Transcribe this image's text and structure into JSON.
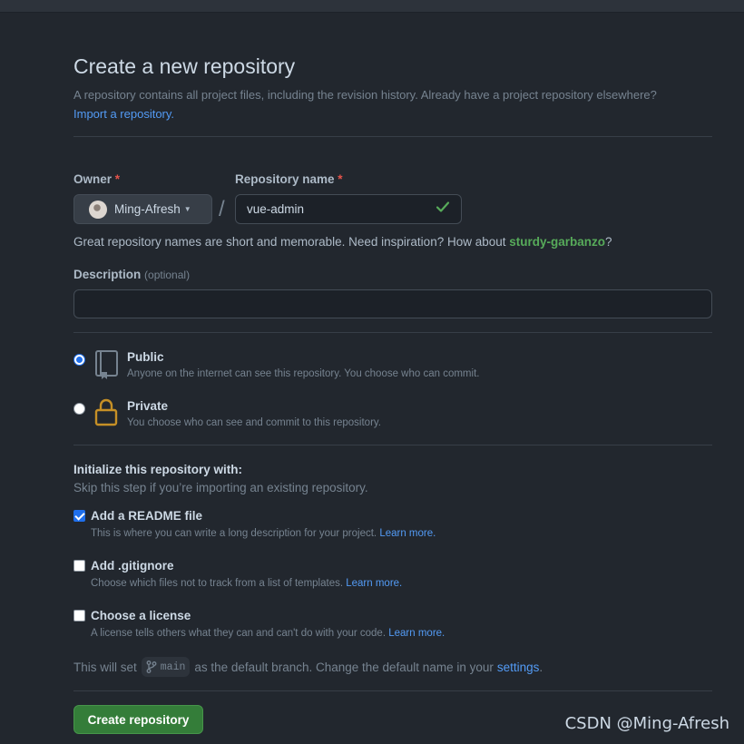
{
  "page": {
    "title": "Create a new repository",
    "subtitle": "A repository contains all project files, including the revision history. Already have a project repository elsewhere?",
    "import_link": "Import a repository."
  },
  "owner": {
    "label": "Owner",
    "required_mark": "*",
    "value": "Ming-Afresh",
    "separator": "/"
  },
  "repo_name": {
    "label": "Repository name",
    "required_mark": "*",
    "value": "vue-admin"
  },
  "hint": {
    "text": "Great repository names are short and memorable. Need inspiration? How about",
    "suggestion": "sturdy-garbanzo",
    "suffix": "?"
  },
  "description": {
    "label": "Description",
    "optional": "(optional)",
    "value": ""
  },
  "visibility": {
    "public": {
      "title": "Public",
      "desc": "Anyone on the internet can see this repository. You choose who can commit.",
      "selected": true
    },
    "private": {
      "title": "Private",
      "desc": "You choose who can see and commit to this repository.",
      "selected": false
    }
  },
  "init": {
    "heading": "Initialize this repository with:",
    "sub": "Skip this step if you’re importing an existing repository.",
    "readme": {
      "title": "Add a README file",
      "desc": "This is where you can write a long description for your project.",
      "link": "Learn more.",
      "checked": true
    },
    "gitignore": {
      "title": "Add .gitignore",
      "desc": "Choose which files not to track from a list of templates.",
      "link": "Learn more.",
      "checked": false
    },
    "license": {
      "title": "Choose a license",
      "desc": "A license tells others what they can and can't do with your code.",
      "link": "Learn more.",
      "checked": false
    }
  },
  "branch": {
    "prefix": "This will set",
    "name": "main",
    "middle": "as the default branch. Change the default name in your",
    "settings_link": "settings",
    "suffix": "."
  },
  "create_button": "Create repository",
  "watermark": "CSDN @Ming-Afresh",
  "colors": {
    "background": "#22272e",
    "accent_link": "#539bf5",
    "success_green": "#57ab5a",
    "button_green": "#347d39",
    "required_red": "#e5534b",
    "lock_gold": "#c69026"
  }
}
